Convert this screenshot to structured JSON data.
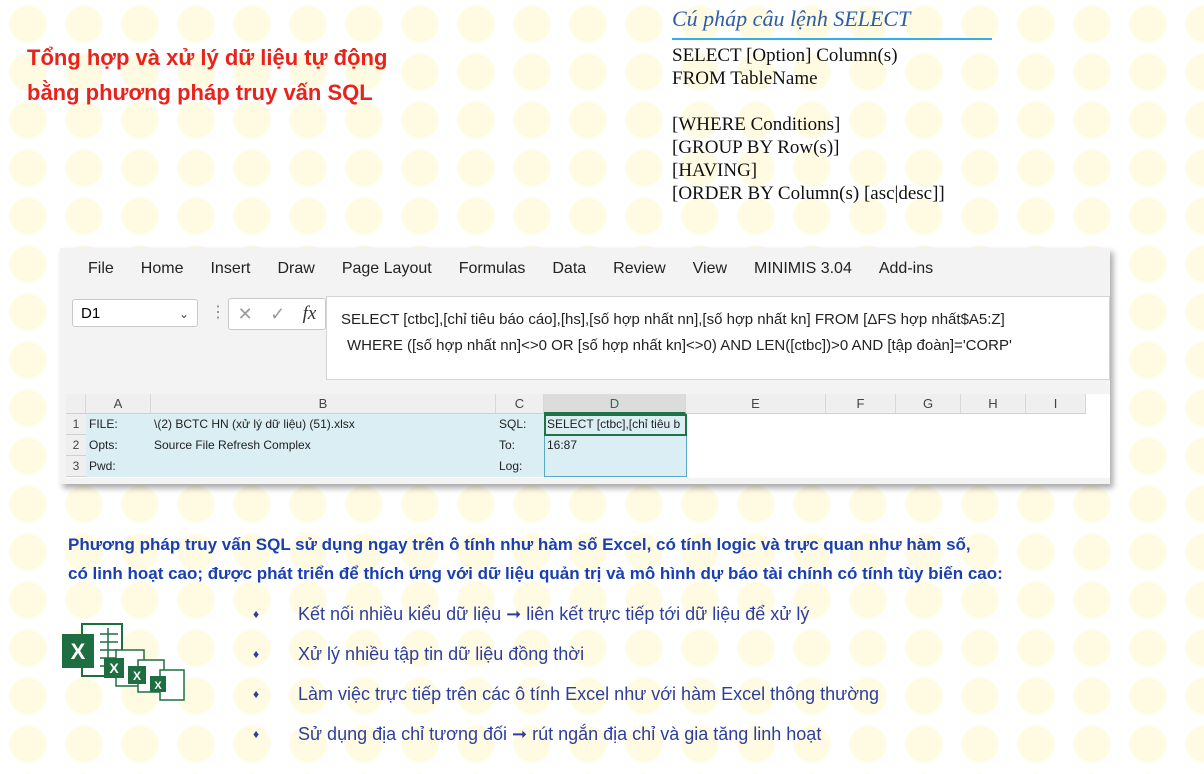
{
  "title": {
    "line1": "Tổng hợp và xử lý dữ liệu tự động",
    "line2": "bằng phương pháp truy vấn SQL"
  },
  "syntax": {
    "heading": "Cú pháp câu lệnh SELECT",
    "lines": [
      "SELECT [Option] Column(s)",
      "FROM TableName",
      "[WHERE Conditions]",
      "[GROUP BY Row(s)]",
      "[HAVING]",
      "[ORDER BY Column(s) [asc|desc]]"
    ]
  },
  "excel": {
    "menu": [
      "File",
      "Home",
      "Insert",
      "Draw",
      "Page Layout",
      "Formulas",
      "Data",
      "Review",
      "View",
      "MINIMIS 3.04",
      "Add-ins"
    ],
    "name_box": "D1",
    "fx": "fx",
    "formula_line1": "SELECT [ctbc],[chỉ tiêu báo cáo],[hs],[số hợp nhất nn],[số hợp nhất kn] FROM [ΔFS hợp nhất$A5:Z]",
    "formula_line2": "WHERE ([số hợp nhất nn]<>0 OR [số hợp nhất kn]<>0) AND LEN([ctbc])>0 AND [tập đoàn]='CORP'",
    "columns": [
      "A",
      "B",
      "C",
      "D",
      "E",
      "F",
      "G",
      "H",
      "I"
    ],
    "rows": [
      "1",
      "2",
      "3"
    ],
    "cells": {
      "a1": "FILE:",
      "a2": "Opts:",
      "a3": "Pwd:",
      "b1": "\\(2) BCTC HN (xử lý dữ liệu) (51).xlsx",
      "b2": "Source File Refresh Complex",
      "c1": "SQL:",
      "c2": "To:",
      "c3": "Log:",
      "d1": "SELECT [ctbc],[chỉ tiêu b",
      "d2": "16:87"
    }
  },
  "description": {
    "line1": "Phương pháp truy vấn SQL sử dụng ngay trên ô tính như hàm số Excel, có tính logic và trực quan như hàm số,",
    "line2": "có linh hoạt cao; được phát triển để thích ứng với dữ liệu quản trị và mô hình dự báo tài chính có tính tùy biến cao:"
  },
  "bullets": [
    "Kết nối nhiều kiểu dữ liệu ➞ liên kết trực tiếp tới dữ liệu để xử lý",
    "Xử lý nhiều tập tin dữ liệu đồng thời",
    "Làm việc trực tiếp trên các ô tính Excel như với hàm Excel thông thường",
    "Sử dụng địa chỉ tương đối ➞ rút ngắn địa chỉ và gia tăng linh hoạt"
  ],
  "bullet_glyph": "♦",
  "colors": {
    "title": "#e8231b",
    "desc": "#1a3fb0",
    "excel_green": "#217346"
  }
}
